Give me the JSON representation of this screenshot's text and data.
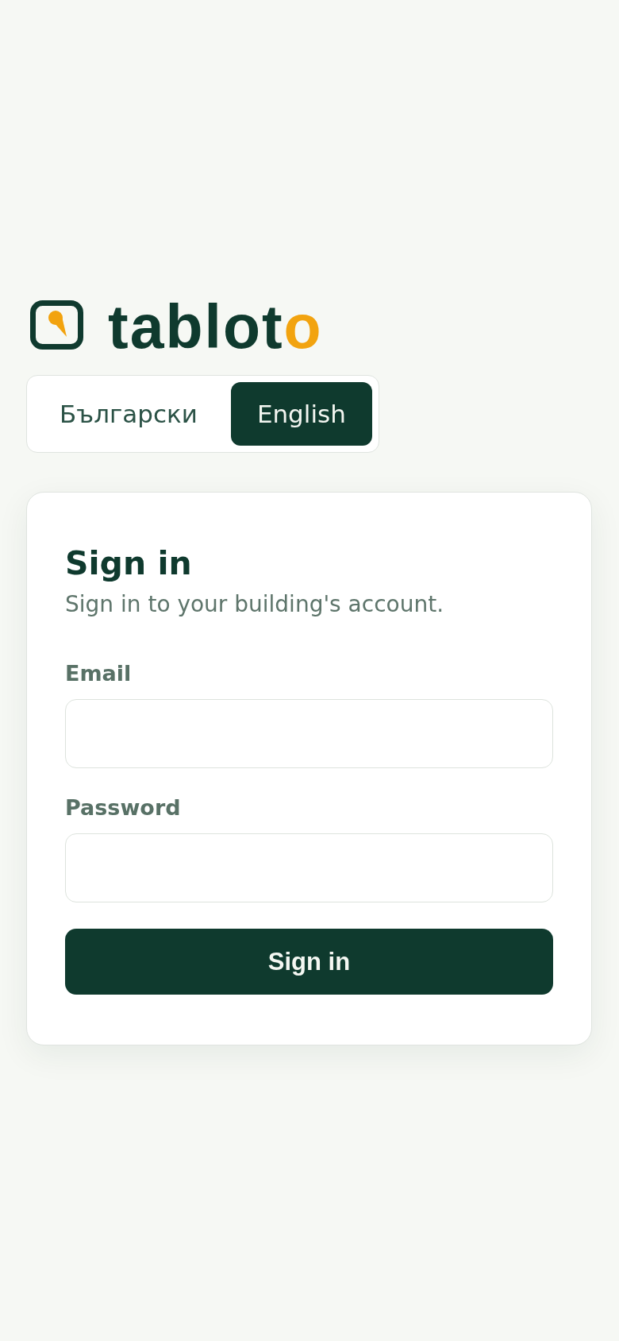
{
  "logo": {
    "wordmark": "tablot",
    "wordmark_accent": "o"
  },
  "languages": [
    {
      "label": "Български",
      "selected": false
    },
    {
      "label": "English",
      "selected": true
    }
  ],
  "sign_in_card": {
    "title": "Sign in",
    "subtitle": "Sign in to your building's account.",
    "fields": [
      {
        "label": "Email"
      },
      {
        "label": "Password"
      }
    ],
    "submit_button": "Sign in"
  }
}
